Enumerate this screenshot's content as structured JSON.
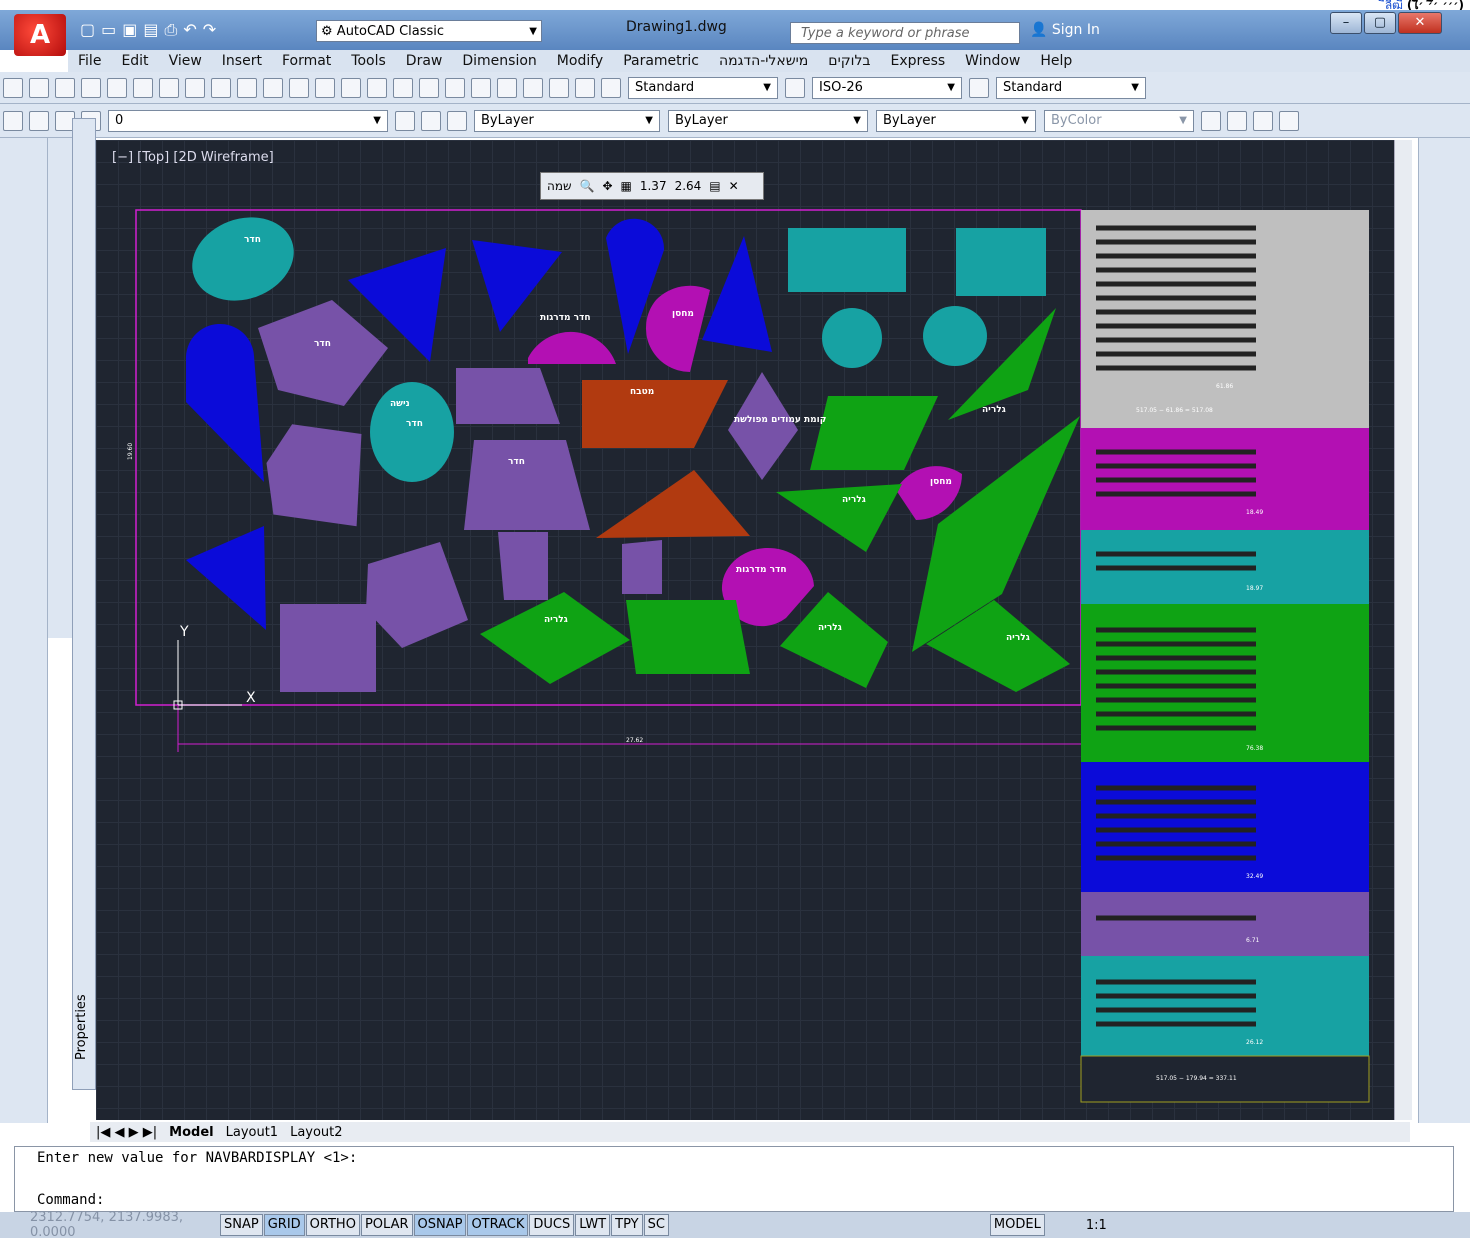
{
  "top_link": {
    "text": "(ใ׳׳׳ ׳ึ׳ ׳ื)",
    "link": "ืลีฒื"
  },
  "app": {
    "workspace": "AutoCAD Classic",
    "document": "Drawing1.dwg",
    "search_placeholder": "Type a keyword or phrase",
    "sign_in": "Sign In"
  },
  "menu": [
    "File",
    "Edit",
    "View",
    "Insert",
    "Format",
    "Tools",
    "Draw",
    "Dimension",
    "Modify",
    "Parametric",
    "מישאלי-הדגמה",
    "בלוקים",
    "Express",
    "Window",
    "Help"
  ],
  "toolbar": {
    "text_style": "Standard",
    "dim_style": "ISO-26",
    "table_style": "Standard",
    "layer": "0",
    "color": "ByLayer",
    "linetype": "ByLayer",
    "lineweight": "ByLayer",
    "plotstyle": "ByColor"
  },
  "viewport": {
    "label": "[−] [Top] [2D Wireframe]"
  },
  "nav_panel": {
    "label": "שמה",
    "scale_a": "1.37",
    "scale_b": "2.64"
  },
  "tabs": [
    "Model",
    "Layout1",
    "Layout2"
  ],
  "command": {
    "line1": "Enter new value for NAVBARDISPLAY <1>:",
    "line2": "Command:"
  },
  "status": {
    "coords": "2312.7754, 2137.9983, 0.0000",
    "buttons": [
      "SNAP",
      "GRID",
      "ORTHO",
      "POLAR",
      "OSNAP",
      "OTRACK",
      "DUCS",
      "LWT",
      "TPY",
      "SC"
    ],
    "active": [
      "GRID",
      "OSNAP",
      "OTRACK"
    ],
    "model": "MODEL",
    "scale": "1:1"
  },
  "props_label": "Properties",
  "drawing": {
    "shape_labels": {
      "room": "חדר",
      "kitchen": "מטבח",
      "balcony": "גלריה",
      "niche": "נישה",
      "stair": "חדר מדרגות",
      "misc": "מחסן",
      "sum": "קומת עמודים מפולשת"
    },
    "panel_totals": [
      "61.86",
      "517.05 − 61.86 = 517.08",
      "18.49",
      "18.97",
      "76.38",
      "32.49",
      "6.71",
      "26.12",
      "517.05 − 179.94 = 337.11"
    ],
    "dims": {
      "horizontal": "27.62",
      "vertical": "19.60"
    }
  },
  "colors": {
    "canvas": "#1f2530",
    "teal": "#17a2a3",
    "purple": "#7752a8",
    "blue": "#0b0bd9",
    "green": "#0fa314",
    "rust": "#b13a10",
    "magenta": "#b310b3",
    "grey": "#bfbfbf"
  }
}
